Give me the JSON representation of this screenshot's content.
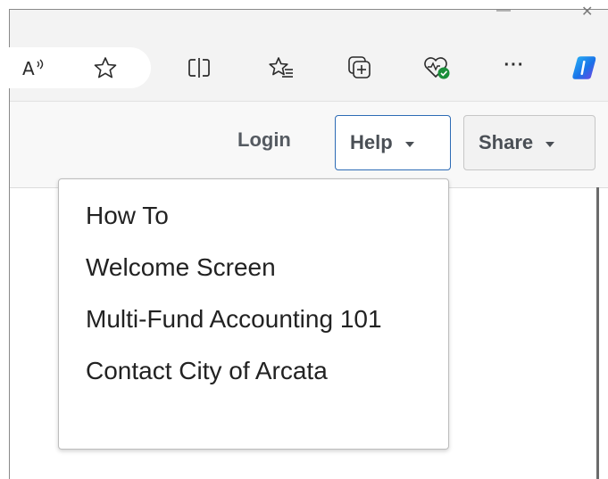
{
  "browser": {
    "toolbar_icons": [
      {
        "name": "read-aloud-icon",
        "glyph": "A"
      },
      {
        "name": "favorite-star-icon"
      },
      {
        "name": "split-screen-icon"
      },
      {
        "name": "favorites-list-icon"
      },
      {
        "name": "collections-icon"
      },
      {
        "name": "browser-essentials-icon"
      },
      {
        "name": "more-options-icon",
        "glyph": "···"
      },
      {
        "name": "copilot-icon"
      }
    ],
    "colors": {
      "accent_green": "#1a8f3a",
      "copilot_blue": "#1a73e8"
    }
  },
  "header": {
    "login_label": "Login",
    "help_label": "Help",
    "share_label": "Share"
  },
  "help_menu": {
    "items": [
      "How To",
      "Welcome Screen",
      "Multi-Fund Accounting 101",
      "Contact City of Arcata"
    ]
  },
  "colors": {
    "focus_border": "#2d6bb5",
    "button_text": "#4a4f55"
  }
}
